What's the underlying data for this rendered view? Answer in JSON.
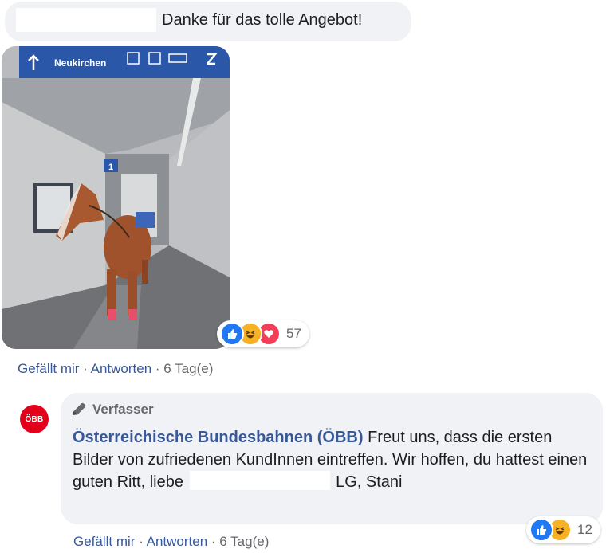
{
  "comment1": {
    "text": "Danke für das tolle Angebot!",
    "photo": {
      "sign_text": "Neukirchen",
      "platform_number": "1"
    },
    "reactions": {
      "types": [
        "like-icon",
        "haha-icon",
        "love-icon"
      ],
      "count": "57"
    },
    "actions": {
      "like": "Gefällt mir",
      "sep": " · ",
      "reply": "Antworten",
      "time": "6 Tag(e)"
    }
  },
  "reply": {
    "avatar_text": "ÖBB",
    "badge": "Verfasser",
    "author": "Österreichische Bundesbahnen (ÖBB)",
    "text_part1": " Freut uns, dass die ersten Bilder von zufriedenen KundInnen eintreffen. Wir hoffen, du hattest einen guten Ritt, liebe ",
    "text_part2": " LG, Stani",
    "reactions": {
      "types": [
        "like-icon",
        "haha-icon"
      ],
      "count": "12"
    },
    "actions": {
      "like": "Gefällt mir",
      "sep": " · ",
      "reply": "Antworten",
      "time": "6 Tag(e)"
    }
  },
  "colors": {
    "link": "#385898",
    "bubble": "#f0f2f5",
    "obb_red": "#e2001a",
    "like": "#2078f4",
    "haha": "#f7b125",
    "love": "#f33e58"
  }
}
